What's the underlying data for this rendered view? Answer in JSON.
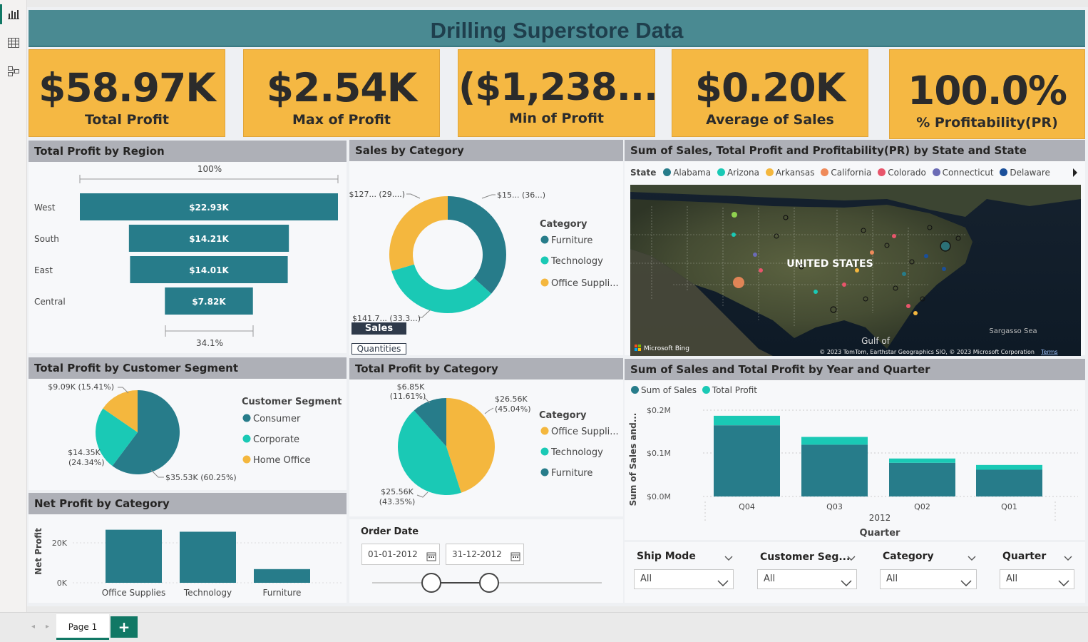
{
  "title": "Drilling Superstore Data",
  "kpis": [
    {
      "value": "$58.97K",
      "label": "Total Profit"
    },
    {
      "value": "$2.54K",
      "label": "Max of Profit"
    },
    {
      "value": "($1,238...",
      "label": "Min of Profit"
    },
    {
      "value": "$0.20K",
      "label": "Average of Sales"
    },
    {
      "value": "100.0%",
      "label": "% Profitability(PR)"
    }
  ],
  "region": {
    "title": "Total Profit by Region",
    "top_pct": "100%",
    "bottom_pct": "34.1%",
    "rows": [
      {
        "name": "West",
        "label": "$22.93K",
        "value": 22.93
      },
      {
        "name": "South",
        "label": "$14.21K",
        "value": 14.21
      },
      {
        "name": "East",
        "label": "$14.01K",
        "value": 14.01
      },
      {
        "name": "Central",
        "label": "$7.82K",
        "value": 7.82
      }
    ]
  },
  "sales_cat": {
    "title": "Sales by Category",
    "legend_title": "Category",
    "legend": [
      "Furniture",
      "Technology",
      "Office Suppli..."
    ],
    "data_labels": [
      "$15... (36...)",
      "$141.7... (33.3...)",
      "$127... (29....)"
    ],
    "toggle_sales": "Sales",
    "toggle_quantities": "Quantities"
  },
  "map": {
    "title": "Sum of Sales, Total Profit and Profitability(PR) by State and State",
    "legend_title": "State",
    "legend": [
      "Alabama",
      "Arizona",
      "Arkansas",
      "California",
      "Colorado",
      "Connecticut",
      "Delaware"
    ],
    "country": "UNITED STATES",
    "gulf": "Gulf of",
    "sea": "Sargasso Sea",
    "bing": "Microsoft Bing",
    "copyright": "© 2023 TomTom, Earthstar Geographics SIO, © 2023 Microsoft Corporation",
    "terms": "Terms"
  },
  "segment": {
    "title": "Total Profit by Customer Segment",
    "legend_title": "Customer Segment",
    "legend": [
      "Consumer",
      "Corporate",
      "Home Office"
    ],
    "label_home": "$9.09K (15.41%)",
    "label_corp_1": "$14.35K",
    "label_corp_2": "(24.34%)",
    "label_cons": "$35.53K (60.25%)"
  },
  "profit_cat": {
    "title": "Total Profit by Category",
    "legend_title": "Category",
    "legend": [
      "Office Suppli...",
      "Technology",
      "Furniture"
    ],
    "label_furn_1": "$6.85K",
    "label_furn_2": "(11.61%)",
    "label_off_1": "$26.56K",
    "label_off_2": "(45.04%)",
    "label_tech_1": "$25.56K",
    "label_tech_2": "(43.35%)"
  },
  "year_q": {
    "title": "Sum of Sales and Total Profit by Year and Quarter",
    "legend": [
      "Sum of Sales",
      "Total Profit"
    ],
    "y_ticks": [
      "$0.2M",
      "$0.1M",
      "$0.0M"
    ],
    "y_label": "Sum of Sales and...",
    "x_title": "Quarter",
    "year": "2012"
  },
  "net_profit": {
    "title": "Net Profit by Category",
    "y_label": "Net Profit",
    "y_ticks": [
      "20K",
      "0K"
    ]
  },
  "order_date": {
    "title": "Order Date",
    "start": "01-01-2012",
    "end": "31-12-2012"
  },
  "slicers": [
    {
      "title": "Ship Mode",
      "value": "All"
    },
    {
      "title": "Customer Seg...",
      "value": "All"
    },
    {
      "title": "Category",
      "value": "All"
    },
    {
      "title": "Quarter",
      "value": "All"
    }
  ],
  "tabs": {
    "page1": "Page 1",
    "add": "+"
  },
  "colors": {
    "teal": "#277c8a",
    "aqua": "#1ac9b5",
    "gold": "#f4b73e",
    "orange": "#ef8a5a",
    "pink": "#e8556b",
    "purple": "#6b6bb5",
    "navy": "#1a4f9a",
    "kpi": "#f5b843",
    "header": "#4a8a92"
  },
  "chart_data": [
    {
      "type": "bar",
      "title": "Total Profit by Region",
      "categories": [
        "West",
        "South",
        "East",
        "Central"
      ],
      "values": [
        22.93,
        14.21,
        14.01,
        7.82
      ],
      "unit": "$K"
    },
    {
      "type": "pie",
      "title": "Sales by Category",
      "categories": [
        "Furniture",
        "Technology",
        "Office Supplies"
      ],
      "values": [
        36,
        33.3,
        29
      ],
      "unit": "%"
    },
    {
      "type": "pie",
      "title": "Total Profit by Customer Segment",
      "categories": [
        "Consumer",
        "Corporate",
        "Home Office"
      ],
      "values": [
        35.53,
        14.35,
        9.09
      ],
      "unit": "$K"
    },
    {
      "type": "pie",
      "title": "Total Profit by Category",
      "categories": [
        "Office Supplies",
        "Technology",
        "Furniture"
      ],
      "values": [
        26.56,
        25.56,
        6.85
      ],
      "unit": "$K"
    },
    {
      "type": "bar",
      "title": "Sum of Sales and Total Profit by Year and Quarter",
      "categories": [
        "Q04",
        "Q03",
        "Q02",
        "Q01"
      ],
      "series": [
        {
          "name": "Sum of Sales",
          "values": [
            0.165,
            0.12,
            0.078,
            0.062
          ]
        },
        {
          "name": "Total Profit",
          "values": [
            0.022,
            0.018,
            0.01,
            0.011
          ]
        }
      ],
      "ylim": [
        0,
        0.2
      ],
      "xlabel": "Quarter",
      "ylabel": "Sum of Sales and..."
    },
    {
      "type": "bar",
      "title": "Net Profit by Category",
      "categories": [
        "Office Supplies",
        "Technology",
        "Furniture"
      ],
      "values": [
        26.56,
        25.56,
        6.85
      ],
      "ylim": [
        0,
        30
      ],
      "ylabel": "Net Profit"
    }
  ]
}
